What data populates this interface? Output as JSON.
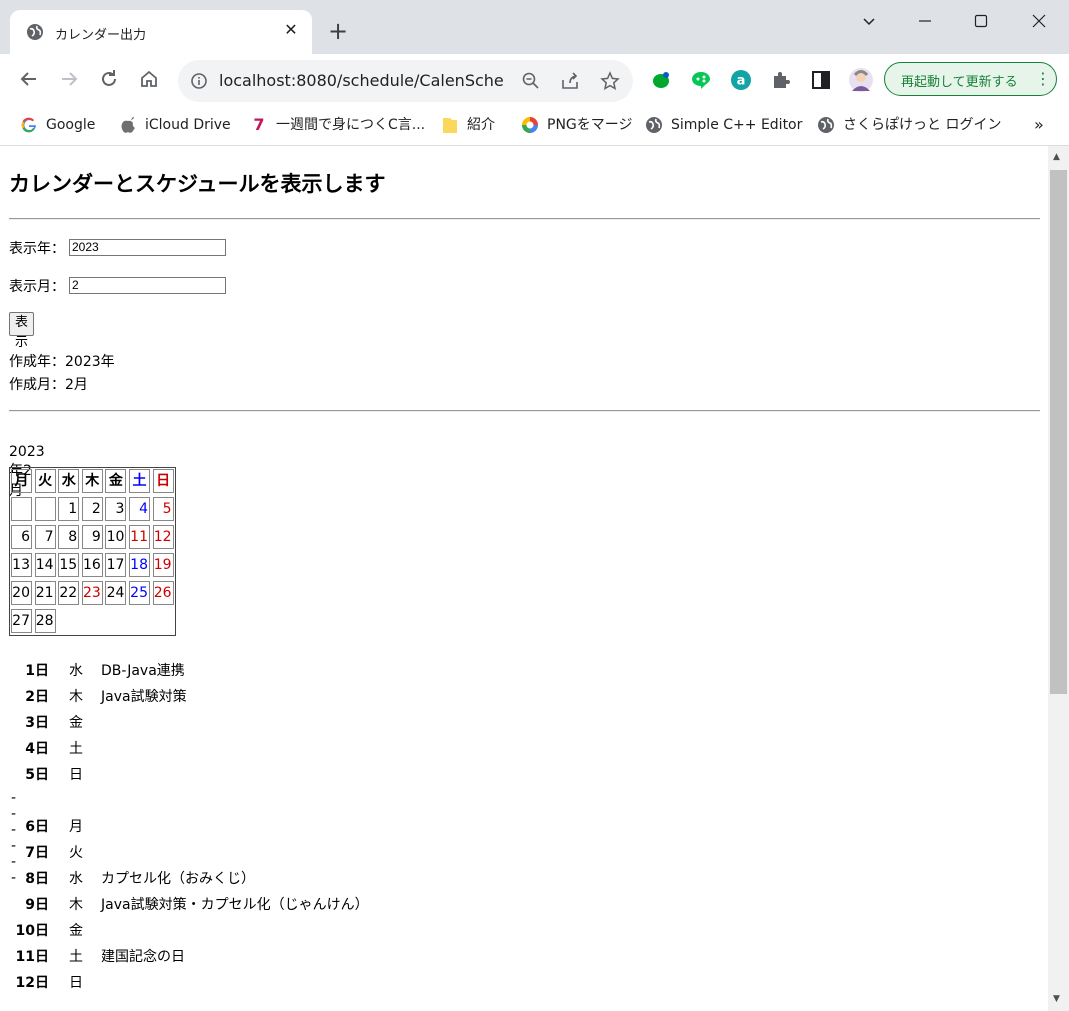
{
  "browser": {
    "tab_title": "カレンダー出力",
    "url": "localhost:8080/schedule/CalenSche",
    "update_label": "再起動して更新する",
    "bookmarks": [
      {
        "label": "Google",
        "icon": "google-icon"
      },
      {
        "label": "iCloud Drive",
        "icon": "apple-icon"
      },
      {
        "label": "一週間で身につくC言...",
        "icon": "seven-icon"
      },
      {
        "label": "紹介",
        "icon": "folder-icon"
      },
      {
        "label": "PNGをマージ",
        "icon": "colorwheel-icon"
      },
      {
        "label": "Simple C++ Editor",
        "icon": "globe-icon"
      },
      {
        "label": "さくらぽけっと ログイン",
        "icon": "globe-icon"
      }
    ],
    "more_bookmarks": "»"
  },
  "page": {
    "heading": "カレンダーとスケジュールを表示します",
    "year_label": "表示年：",
    "year_value": "2023",
    "month_label": "表示月：",
    "month_value": "2",
    "submit_label": "表示",
    "made_year": "作成年：2023年",
    "made_month": "作成月：2月"
  },
  "calendar": {
    "title": "2023年2月",
    "headers": [
      "月",
      "火",
      "水",
      "木",
      "金",
      "土",
      "日"
    ],
    "weeks": [
      [
        "",
        "",
        "1",
        "2",
        "3",
        "4",
        "5"
      ],
      [
        "6",
        "7",
        "8",
        "9",
        "10",
        "11",
        "12"
      ],
      [
        "13",
        "14",
        "15",
        "16",
        "17",
        "18",
        "19"
      ],
      [
        "20",
        "21",
        "22",
        "23",
        "24",
        "25",
        "26"
      ],
      [
        "27",
        "28",
        "",
        "",
        "",
        "",
        ""
      ]
    ],
    "holidays": [
      "11",
      "23"
    ],
    "colors": {
      "saturday": "#0000ff",
      "sunday": "#cc0000",
      "weekday": "#000000"
    }
  },
  "schedule": {
    "separator": "------",
    "rows": [
      {
        "day": "1日",
        "weekday": "水",
        "event": "DB-Java連携"
      },
      {
        "day": "2日",
        "weekday": "木",
        "event": "Java試験対策"
      },
      {
        "day": "3日",
        "weekday": "金",
        "event": ""
      },
      {
        "day": "4日",
        "weekday": "土",
        "event": ""
      },
      {
        "day": "5日",
        "weekday": "日",
        "event": ""
      },
      {
        "sep": true
      },
      {
        "day": "6日",
        "weekday": "月",
        "event": ""
      },
      {
        "day": "7日",
        "weekday": "火",
        "event": ""
      },
      {
        "day": "8日",
        "weekday": "水",
        "event": "カプセル化（おみくじ）"
      },
      {
        "day": "9日",
        "weekday": "木",
        "event": "Java試験対策・カプセル化（じゃんけん）"
      },
      {
        "day": "10日",
        "weekday": "金",
        "event": ""
      },
      {
        "day": "11日",
        "weekday": "土",
        "event": "建国記念の日"
      },
      {
        "day": "12日",
        "weekday": "日",
        "event": ""
      }
    ]
  }
}
